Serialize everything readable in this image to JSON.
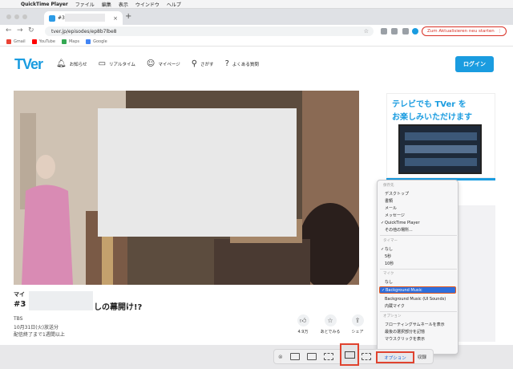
{
  "menubar": {
    "app": "QuickTime Player",
    "items": [
      "ファイル",
      "編集",
      "表示",
      "ウインドウ",
      "ヘルプ"
    ]
  },
  "browser": {
    "tab_title": "#3",
    "new_tab": "+",
    "url": "tver.jp/episodes/ep8b7lbe8",
    "relaunch_label": "Zum Aktualisieren neu starten",
    "bookmarks": [
      "Gmail",
      "YouTube",
      "Maps",
      "Google"
    ]
  },
  "site": {
    "logo": "TVer",
    "nav": [
      "お知らせ",
      "リアルタイム",
      "マイページ",
      "さがす",
      "よくある質問"
    ],
    "login": "ログイン",
    "episode_prefix": "マイ",
    "episode_number": "#3",
    "episode_title_tail": "しの幕開け!?",
    "broadcaster": "TBS",
    "air_date": "10月31日(火)放送分",
    "expiry": "配信終了まで1週間以上",
    "actions": [
      "4.9万",
      "あとでみる",
      "シェア"
    ],
    "ad_line1": "テレビでも TVer を",
    "ad_line2": "お楽しみいただけます"
  },
  "qt_menu": {
    "sections": {
      "save_to": "保存先",
      "timer": "タイマー",
      "microphone": "マイク",
      "options": "オプション"
    },
    "save_items": [
      "デスクトップ",
      "書類",
      "メール",
      "メッセージ",
      "QuickTime Player",
      "その他の場所..."
    ],
    "timer_items": [
      "なし",
      "5秒",
      "10秒"
    ],
    "mic_items": [
      "なし",
      "Background Music",
      "Background Music (UI Sounds)",
      "内蔵マイク"
    ],
    "option_items": [
      "フローティングサムネールを表示",
      "最後の選択部分を記憶",
      "マウスクリックを表示"
    ]
  },
  "qt_toolbar": {
    "options_label": "オプション",
    "record_label": "収録"
  },
  "colors": {
    "accent": "#1a9ce0",
    "highlight_border": "#e0432f",
    "selection": "#2f6fdc"
  }
}
